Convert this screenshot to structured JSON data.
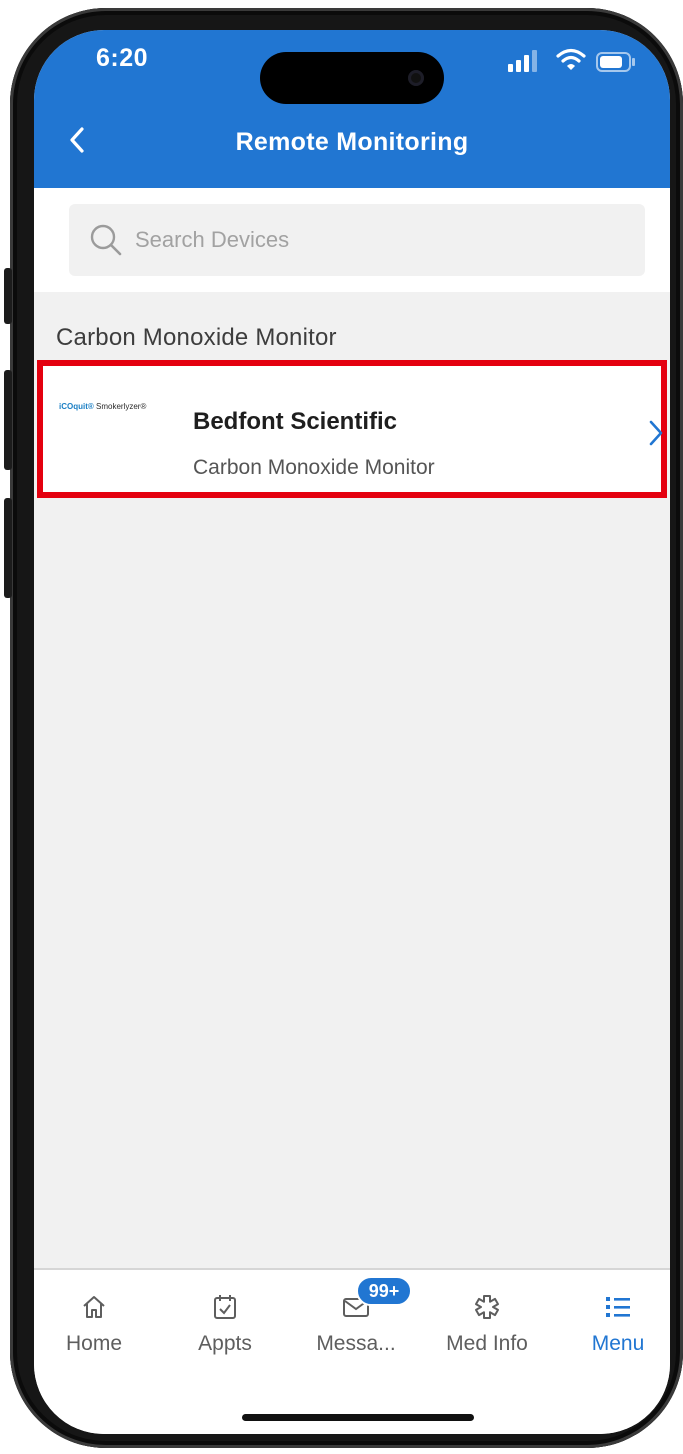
{
  "status_bar": {
    "time": "6:20",
    "signal_icon": "cellular-signal-icon",
    "wifi_icon": "wifi-icon",
    "battery_icon": "battery-icon"
  },
  "header": {
    "title": "Remote Monitoring",
    "back_icon": "chevron-left-icon",
    "background_color": "#2176d2"
  },
  "search": {
    "placeholder": "Search Devices",
    "value": "",
    "icon": "search-icon"
  },
  "sections": [
    {
      "title": "Carbon Monoxide Monitor",
      "devices": [
        {
          "logo_text_primary": "iCOquit®",
          "logo_text_secondary": "Smokerlyzer®",
          "name": "Bedfont Scientific",
          "type": "Carbon Monoxide Monitor",
          "highlighted": true,
          "highlight_color": "#e4000f"
        }
      ]
    }
  ],
  "tab_bar": {
    "tabs": [
      {
        "label": "Home",
        "icon": "home-icon",
        "active": false
      },
      {
        "label": "Appts",
        "icon": "calendar-check-icon",
        "active": false
      },
      {
        "label": "Messa...",
        "icon": "envelope-icon",
        "active": false,
        "badge": "99+"
      },
      {
        "label": "Med Info",
        "icon": "medical-star-icon",
        "active": false
      },
      {
        "label": "Menu",
        "icon": "list-icon",
        "active": true
      }
    ],
    "active_color": "#2176d2"
  }
}
